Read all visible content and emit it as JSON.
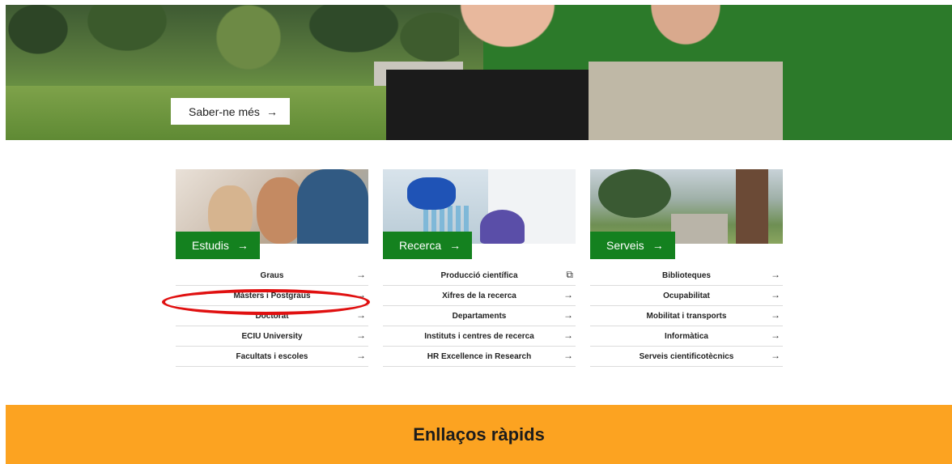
{
  "hero": {
    "button_label": "Saber-ne més",
    "button_arrow": "→"
  },
  "cards": [
    {
      "id": "estudis",
      "tag_label": "Estudis",
      "links": [
        {
          "label": "Graus",
          "icon": "→"
        },
        {
          "label": "Màsters i Postgraus",
          "icon": "→"
        },
        {
          "label": "Doctorat",
          "icon": "→"
        },
        {
          "label": "ECIU University",
          "icon": "→"
        },
        {
          "label": "Facultats i escoles",
          "icon": "→"
        }
      ]
    },
    {
      "id": "recerca",
      "tag_label": "Recerca",
      "links": [
        {
          "label": "Producció científica",
          "icon": "⧉"
        },
        {
          "label": "Xifres de la recerca",
          "icon": "→"
        },
        {
          "label": "Departaments",
          "icon": "→"
        },
        {
          "label": "Instituts i centres de recerca",
          "icon": "→"
        },
        {
          "label": "HR Excellence in Research",
          "icon": "→"
        }
      ]
    },
    {
      "id": "serveis",
      "tag_label": "Serveis",
      "links": [
        {
          "label": "Biblioteques",
          "icon": "→"
        },
        {
          "label": "Ocupabilitat",
          "icon": "→"
        },
        {
          "label": "Mobilitat i transports",
          "icon": "→"
        },
        {
          "label": "Informàtica",
          "icon": "→"
        },
        {
          "label": "Serveis cientificotècnics",
          "icon": "→"
        }
      ]
    }
  ],
  "tag_arrow": "→",
  "quick_links": {
    "title": "Enllaços ràpids"
  },
  "colors": {
    "green": "#14811f",
    "orange": "#fca321",
    "annotation_red": "#e01010"
  }
}
